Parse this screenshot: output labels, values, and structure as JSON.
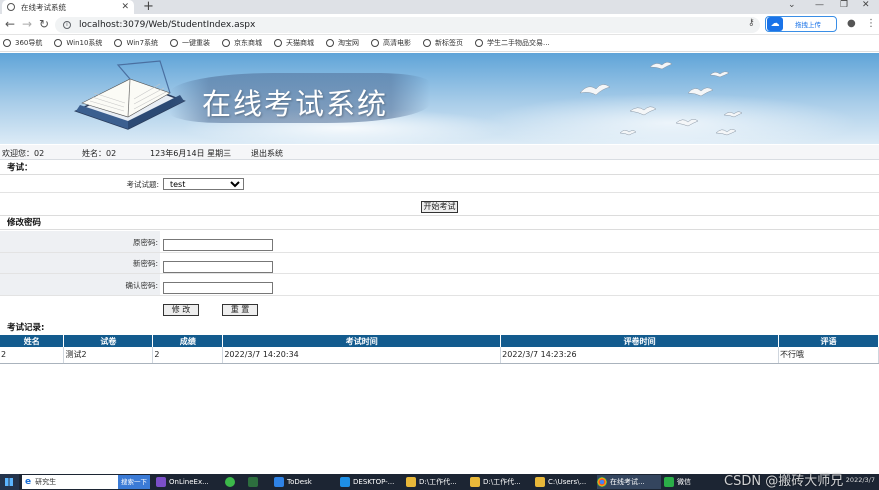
{
  "browser": {
    "tab_title": "在线考试系统",
    "url": "localhost:3079/Web/StudentIndex.aspx",
    "extension_label": "拖拽上传",
    "bookmarks": [
      "360导航",
      "Win10系统",
      "Win7系统",
      "一键重装",
      "京东商城",
      "天猫商城",
      "淘宝网",
      "高清电影",
      "新标签页",
      "学生二手物品交易..."
    ]
  },
  "banner": {
    "title": "在线考试系统"
  },
  "userbar": {
    "welcome": "欢迎您：02",
    "name": "姓名：02",
    "date": "123年6月14日 星期三",
    "logout": "退出系统"
  },
  "exam": {
    "section_title": "考试：",
    "select_label": "考试试题:",
    "selected_value": "test",
    "start_button": "开始考试"
  },
  "password": {
    "section_title": "修改密码",
    "old_label": "原密码:",
    "new_label": "新密码:",
    "confirm_label": "确认密码:",
    "submit_button": "修 改",
    "reset_button": "重 置"
  },
  "records": {
    "section_title": "考试记录:",
    "columns": [
      "姓名",
      "试卷",
      "成绩",
      "考试时间",
      "评卷时间",
      "评语"
    ],
    "rows": [
      [
        "2",
        "测试2",
        "2",
        "2022/3/7 14:20:34",
        "2022/3/7 14:23:26",
        "不行哦"
      ]
    ]
  },
  "taskbar": {
    "search_text": "研究生",
    "search_button": "搜索一下",
    "items": [
      "OnLineEx...",
      "ToDesk",
      "DESKTOP-...",
      "D:\\工作代...",
      "D:\\工作代...",
      "C:\\Users\\...",
      "在线考试...",
      "微信"
    ],
    "clock": "2022/3/7"
  },
  "watermark": "CSDN @搬砖大师兄",
  "colors": {
    "grid_header": "#135b8e",
    "banner_sky": "#5fa4d8"
  }
}
